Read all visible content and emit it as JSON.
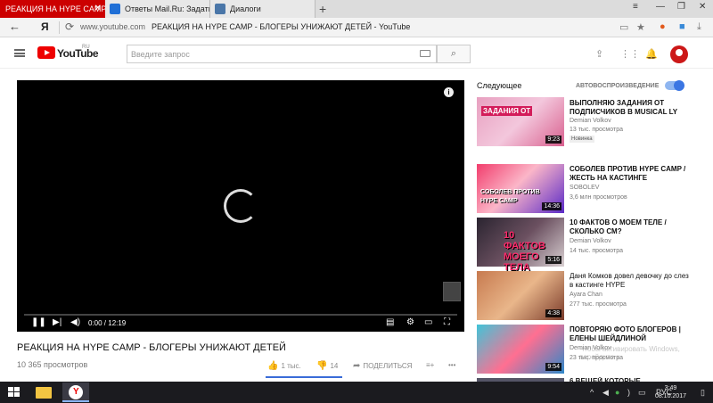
{
  "browser": {
    "tabs": [
      {
        "label": "РЕАКЦИЯ НА HYPE CAMP",
        "close": "✕"
      },
      {
        "label": "Ответы Mail.Ru: Задать воп"
      },
      {
        "label": "Диалоги"
      }
    ],
    "new_tab": "+",
    "address_domain": "www.youtube.com",
    "address_title": "РЕАКЦИЯ НА HYPE CAMP - БЛОГЕРЫ УНИЖАЮТ ДЕТЕЙ - YouTube",
    "yandex_btn": "Я"
  },
  "youtube": {
    "logo_text": "YouTube",
    "logo_region": "RU",
    "search_placeholder": "Введите запрос",
    "player": {
      "time": "0:00 / 12:19",
      "info": "i",
      "progress": 0.0
    },
    "video": {
      "title": "РЕАКЦИЯ НА HYPE CAMP - БЛОГЕРЫ УНИЖАЮТ ДЕТЕЙ",
      "views": "10 365 просмотров",
      "likes": "1 тыс.",
      "dislikes": "14",
      "share": "ПОДЕЛИТЬСЯ"
    },
    "sidebar": {
      "next_label": "Следующее",
      "autoplay_label": "АВТОВОСПРОИЗВЕДЕНИЕ",
      "autoplay_on": true,
      "items": [
        {
          "title": "ВЫПОЛНЯЮ ЗАДАНИЯ ОТ ПОДПИСЧИКОВ В MUSICAL LY",
          "channel": "Demian Volkov",
          "views": "13 тыс. просмотра",
          "badge": "Новинка",
          "duration": "9:23"
        },
        {
          "title": "СОБОЛЕВ ПРОТИВ HYPE CAMP / ЖЕСТЬ НА КАСТИНГЕ",
          "channel": "SOBOLEV",
          "views": "3,6 млн просмотров",
          "duration": "14:36"
        },
        {
          "title": "10 ФАКТОВ О МОЕМ ТЕЛЕ / СКОЛЬКО СМ?",
          "channel": "Demian Volkov",
          "views": "14 тыс. просмотра",
          "duration": "5:16"
        },
        {
          "title": "Даня Комков довел девочку до слез в кастинге HYPE",
          "channel": "Ayara Chan",
          "views": "277 тыс. просмотра",
          "duration": "4:38"
        },
        {
          "title": "ПОВТОРЯЮ ФОТО БЛОГЕРОВ | ЕЛЕНЫ ШЕЙДЛИНОЙ",
          "channel": "Demian Volkov",
          "views": "23 тыс. просмотра",
          "duration": "9:54"
        },
        {
          "title": "6 ВЕЩЕЙ КОТОРЫЕ"
        }
      ],
      "thumb_texts": {
        "t1": "ЗАДАНИЯ ОТ",
        "t2a": "СОБОЛЕВ ПРОТИВ",
        "t2b": "HYPE CAMP",
        "t3": "10 ФАКТОВ МОЕГО ТЕЛА"
      }
    }
  },
  "taskbar": {
    "lang": "РУС",
    "time": "3:49",
    "date": "08.10.2017"
  },
  "watermark": "Чтобы активировать Windows, перейдите к",
  "colors": {
    "yt_red": "#e00000",
    "tab_active": "#cc0000",
    "like_blue": "#3a6cd8"
  }
}
